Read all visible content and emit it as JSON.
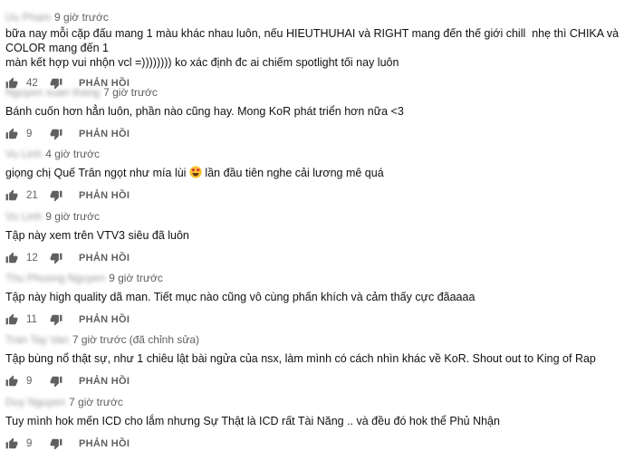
{
  "comments": [
    {
      "author": "Uu Pham",
      "time": "9 giờ trước",
      "edited": "",
      "text": "bữa nay mỗi cặp đấu mang 1 màu khác nhau luôn, nếu HIEUTHUHAI và RIGHT mang đến thế giới chill  nhẹ thì CHIKA và COLOR mang đến 1\nmàn kết hợp vui nhộn vcl =)))))))) ko xác định đc ai chiếm spotlight tối nay luôn",
      "likes": "42",
      "reply_label": "PHẢN HỒI"
    },
    {
      "author": "Nguyen xuan thang",
      "time": "7 giờ trước",
      "edited": "",
      "text": "Bánh cuốn hơn hẳn luôn, phần nào cũng hay. Mong KoR phát triển hơn nữa <3",
      "likes": "9",
      "reply_label": "PHẢN HỒI"
    },
    {
      "author": "Vu Linh",
      "time": "4 giờ trước",
      "edited": "",
      "text_before": "giọng chị Quế Trân ngọt như mía lùi ",
      "emoji": "heart-eyes-emoji",
      "text_after": " lần đầu tiên nghe cải lương mê quá",
      "likes": "21",
      "reply_label": "PHẢN HỒI"
    },
    {
      "author": "Vu Linh",
      "time": "9 giờ trước",
      "edited": "",
      "text": "Tập này xem trên VTV3 siêu đã luôn",
      "likes": "12",
      "reply_label": "PHẢN HỒI"
    },
    {
      "author": "Thu Phuong Nguyen",
      "time": "9 giờ trước",
      "edited": "",
      "text": "Tập này high quality dã man. Tiết mục nào cũng vô cùng phấn khích và cảm thấy cực đãaaaa",
      "likes": "11",
      "reply_label": "PHẢN HỒI"
    },
    {
      "author": "Tran Tay Van",
      "time": "7 giờ trước",
      "edited": "(đã chỉnh sửa)",
      "text": "Tập bùng nổ thật sự, như 1 chiêu lật bài ngửa của nsx, làm mình có cách nhìn khác về KoR. Shout out to King of Rap",
      "likes": "9",
      "reply_label": "PHẢN HỒI"
    },
    {
      "author": "Duy Nguyen",
      "time": "7 giờ trước",
      "edited": "",
      "text": "Tuy mình hok mến ICD cho lắm nhưng Sự Thật là ICD rất Tài Năng .. và đều đó hok thể Phủ Nhận",
      "likes": "9",
      "reply_label": "PHẢN HỒI"
    }
  ],
  "icons": {
    "like": "thumbs-up-icon",
    "dislike": "thumbs-down-icon"
  },
  "colors": {
    "meta": "#606060",
    "text": "#111111",
    "background": "#ffffff"
  }
}
